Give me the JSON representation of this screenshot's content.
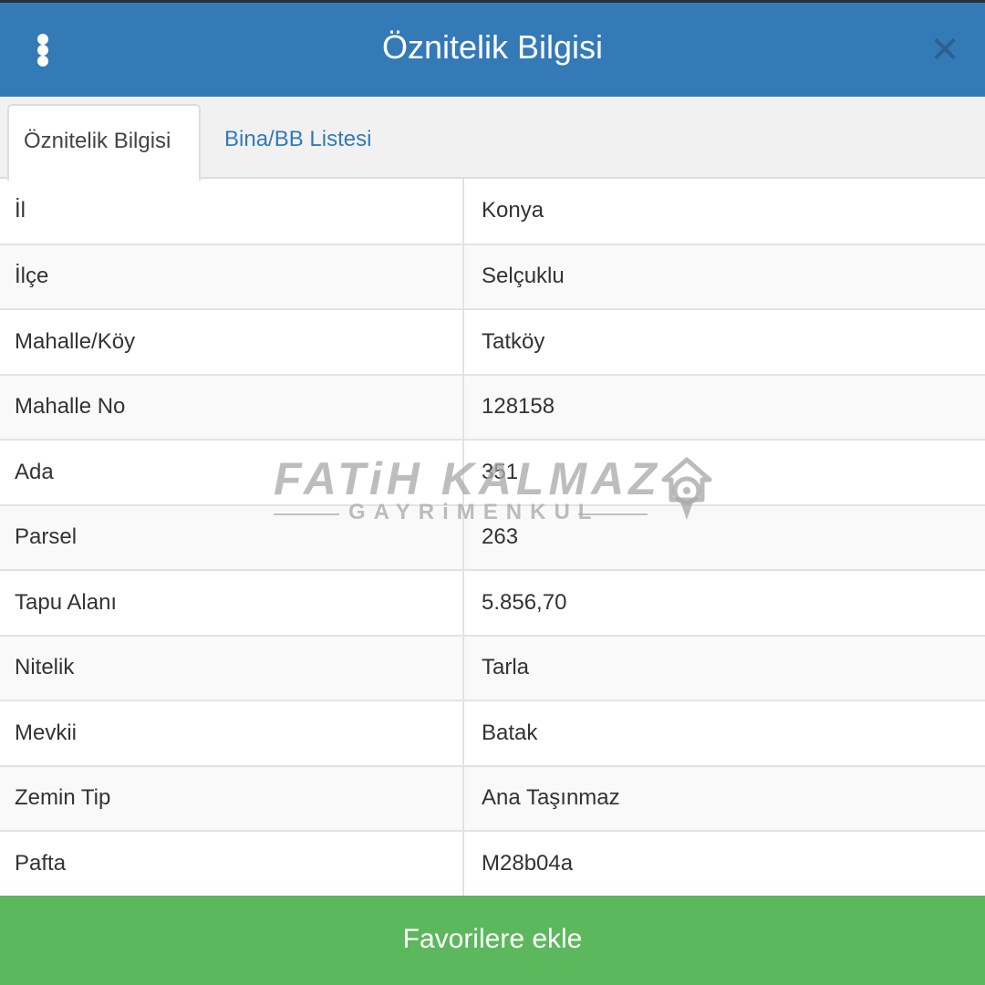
{
  "dialog": {
    "title": "Öznitelik Bilgisi",
    "menu_icon": "vertical-dots-icon",
    "close_icon": "close-icon",
    "close_glyph": "✕"
  },
  "tabs": [
    {
      "label": "Öznitelik Bilgisi",
      "active": true
    },
    {
      "label": "Bina/BB Listesi",
      "active": false
    }
  ],
  "attributes": [
    {
      "key": "İl",
      "value": "Konya"
    },
    {
      "key": "İlçe",
      "value": "Selçuklu"
    },
    {
      "key": "Mahalle/Köy",
      "value": "Tatköy"
    },
    {
      "key": "Mahalle No",
      "value": "128158"
    },
    {
      "key": "Ada",
      "value": "351"
    },
    {
      "key": "Parsel",
      "value": "263"
    },
    {
      "key": "Tapu Alanı",
      "value": "5.856,70"
    },
    {
      "key": "Nitelik",
      "value": "Tarla"
    },
    {
      "key": "Mevkii",
      "value": "Batak"
    },
    {
      "key": "Zemin Tip",
      "value": "Ana Taşınmaz"
    },
    {
      "key": "Pafta",
      "value": "M28b04a"
    }
  ],
  "watermark": {
    "name": "FATiH KALMAZ",
    "subtitle": "GAYRiMENKUL",
    "logo_icon": "house-location-pin-icon"
  },
  "footer": {
    "favorite_label": "Favorilere ekle"
  },
  "colors": {
    "header": "#337ab7",
    "link": "#337ab7",
    "favorite_button": "#5cb85c"
  }
}
